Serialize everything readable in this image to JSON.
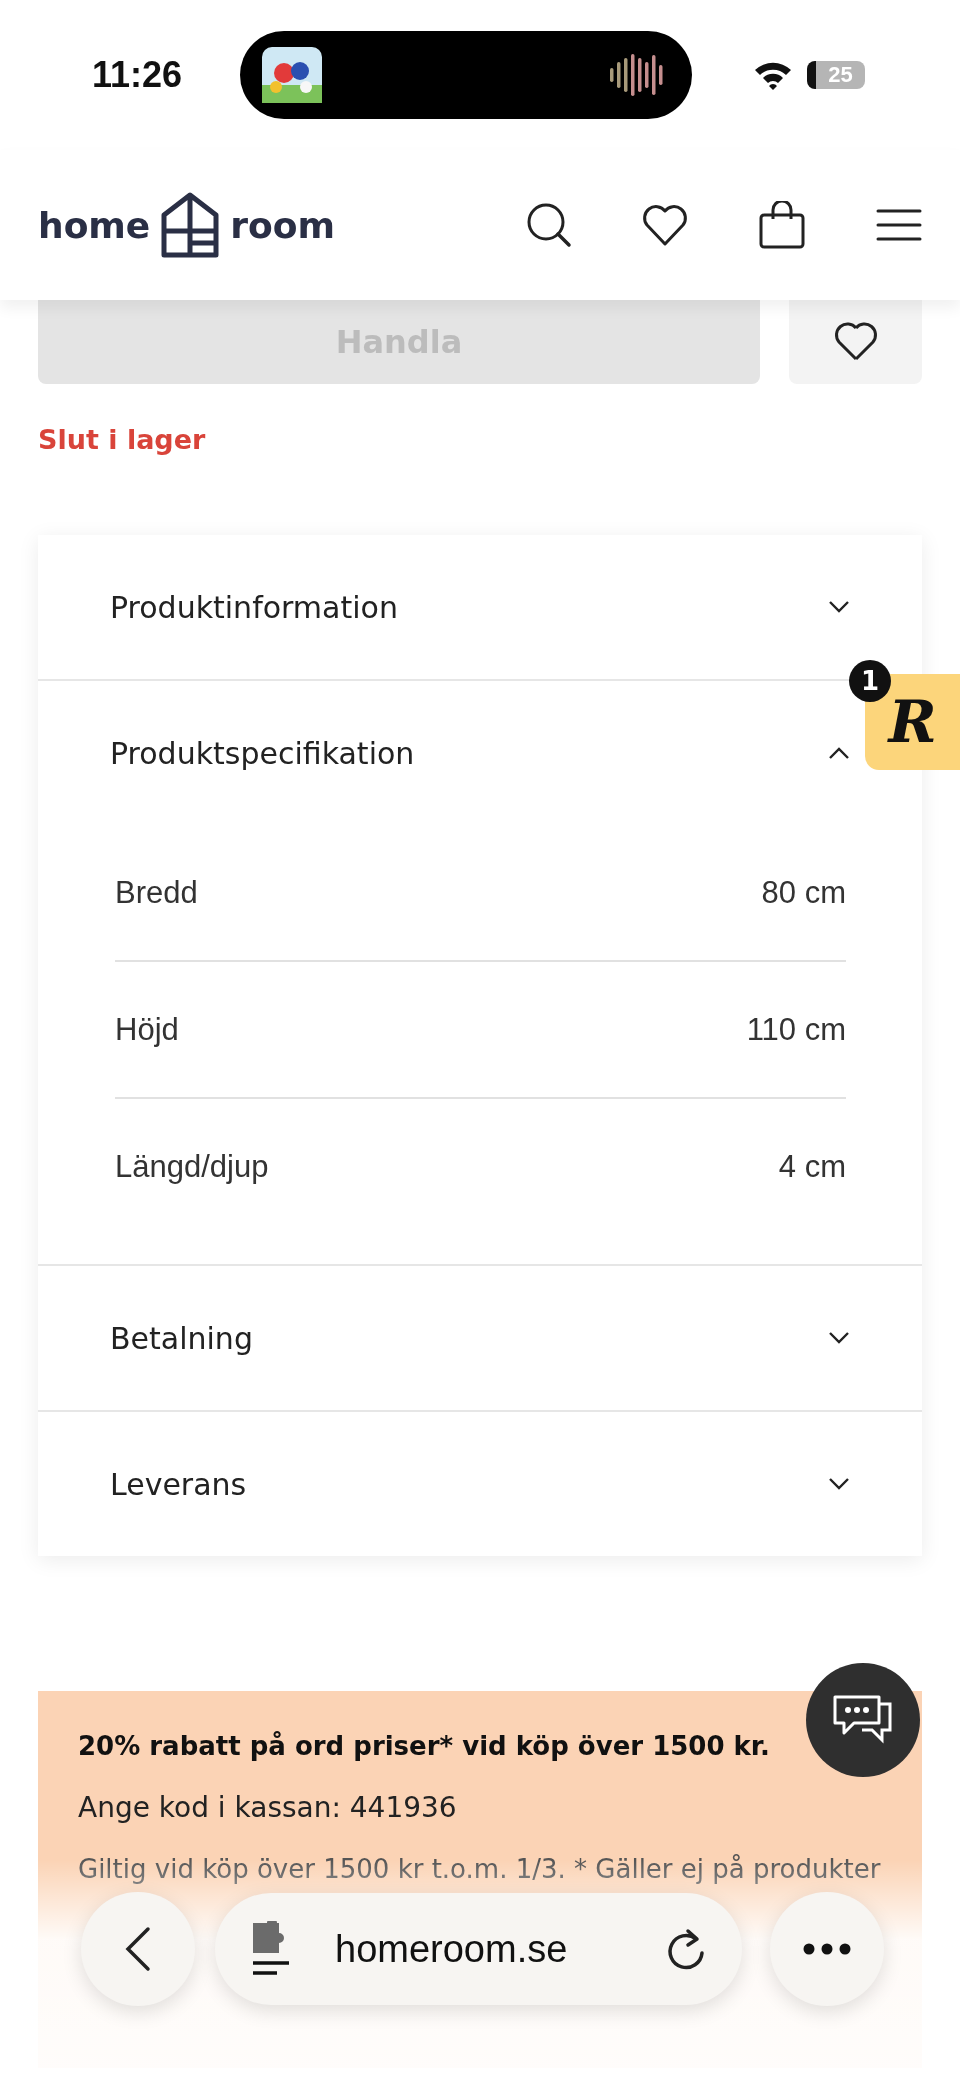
{
  "status_bar": {
    "time": "11:26",
    "battery": "25"
  },
  "header": {
    "logo_left": "home",
    "logo_right": "room"
  },
  "buy": {
    "button": "Handla",
    "disabled": true,
    "stock": "Slut i lager"
  },
  "accordion": [
    {
      "title": "Produktinformation",
      "expanded": false
    },
    {
      "title": "Produktspecifikation",
      "expanded": true,
      "specs": [
        {
          "label": "Bredd",
          "value": "80 cm"
        },
        {
          "label": "Höjd",
          "value": "110 cm"
        },
        {
          "label": "Längd/djup",
          "value": "4 cm"
        }
      ]
    },
    {
      "title": "Betalning",
      "expanded": false
    },
    {
      "title": "Leverans",
      "expanded": false
    }
  ],
  "reviews_badge": {
    "letter": "R",
    "count": "1"
  },
  "promo": {
    "headline": "20% rabatt på ord priser* vid köp över 1500 kr.",
    "code_line": "Ange kod i kassan: 441936",
    "terms": "Giltig vid köp över 1500 kr t.o.m. 1/3. * Gäller ej på produkter"
  },
  "browser_bar": {
    "url": "homeroom.se"
  }
}
